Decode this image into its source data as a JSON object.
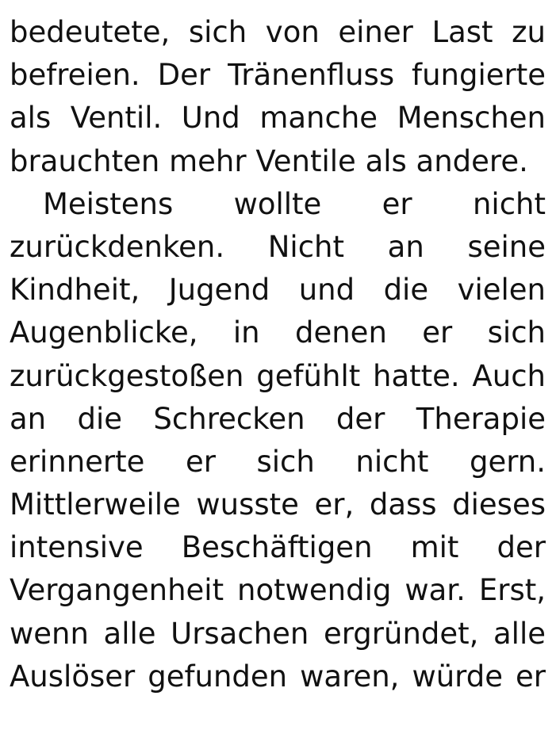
{
  "text": {
    "paragraph_1_lines": [
      "bedeutete, sich von einer Last zu",
      "befreien. Der Tränenfluss fungierte",
      "als Ventil. Und manche Menschen",
      "brauchten mehr Ventile als andere."
    ],
    "paragraph_2_lines": [
      "Meistens wollte er nicht",
      "zurückdenken. Nicht an seine",
      "Kindheit, Jugend und die vielen",
      "Augenblicke, in denen er sich",
      "zurückgestoßen gefühlt hatte. Auch",
      "an die Schrecken der Therapie",
      "erinnerte er sich nicht gern.",
      "Mittlerweile wusste er, dass dieses",
      "intensive Beschäftigen mit der",
      "Vergangenheit notwendig war. Erst,",
      "wenn alle Ursachen ergründet, alle",
      "Auslöser gefunden waren, würde er"
    ]
  }
}
